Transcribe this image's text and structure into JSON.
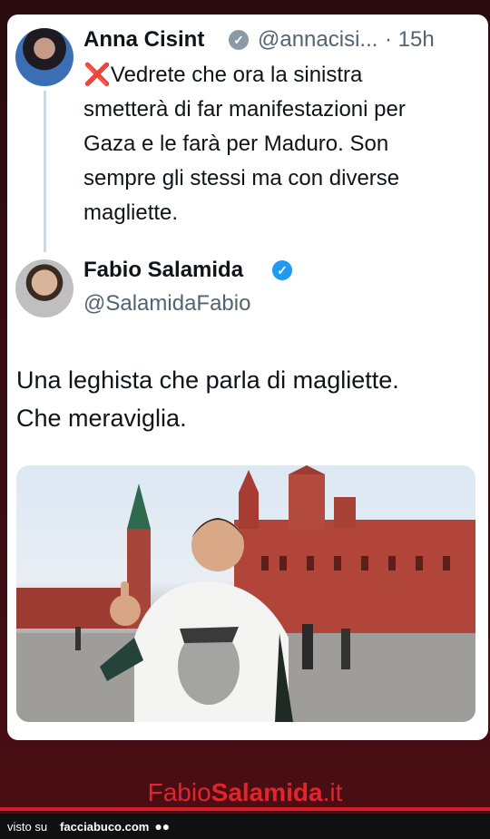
{
  "tweet_quoted": {
    "author_name": "Anna Cisint",
    "handle": "@annacisi...",
    "time": "· 15h",
    "x_emoji": "❌",
    "text_lines": [
      "Vedrete che ora la sinistra",
      "smetterà di far manifestazioni per",
      "Gaza e le farà per Maduro. Son",
      "sempre gli stessi ma con diverse",
      "magliette."
    ]
  },
  "tweet_reply": {
    "author_name": "Fabio Salamida",
    "handle": "@SalamidaFabio",
    "text_lines": [
      "Una leghista che parla di magliette.",
      "Che meraviglia."
    ]
  },
  "footer": {
    "brand_part1": "Fabio",
    "brand_part2": "Salamida",
    "brand_part3": ".it",
    "visto_su": "visto su",
    "site": "facciabuco.com"
  },
  "colors": {
    "verified_gray": "#8b98a5",
    "verified_blue": "#1d9bf0",
    "brand_red": "#e2242c"
  }
}
